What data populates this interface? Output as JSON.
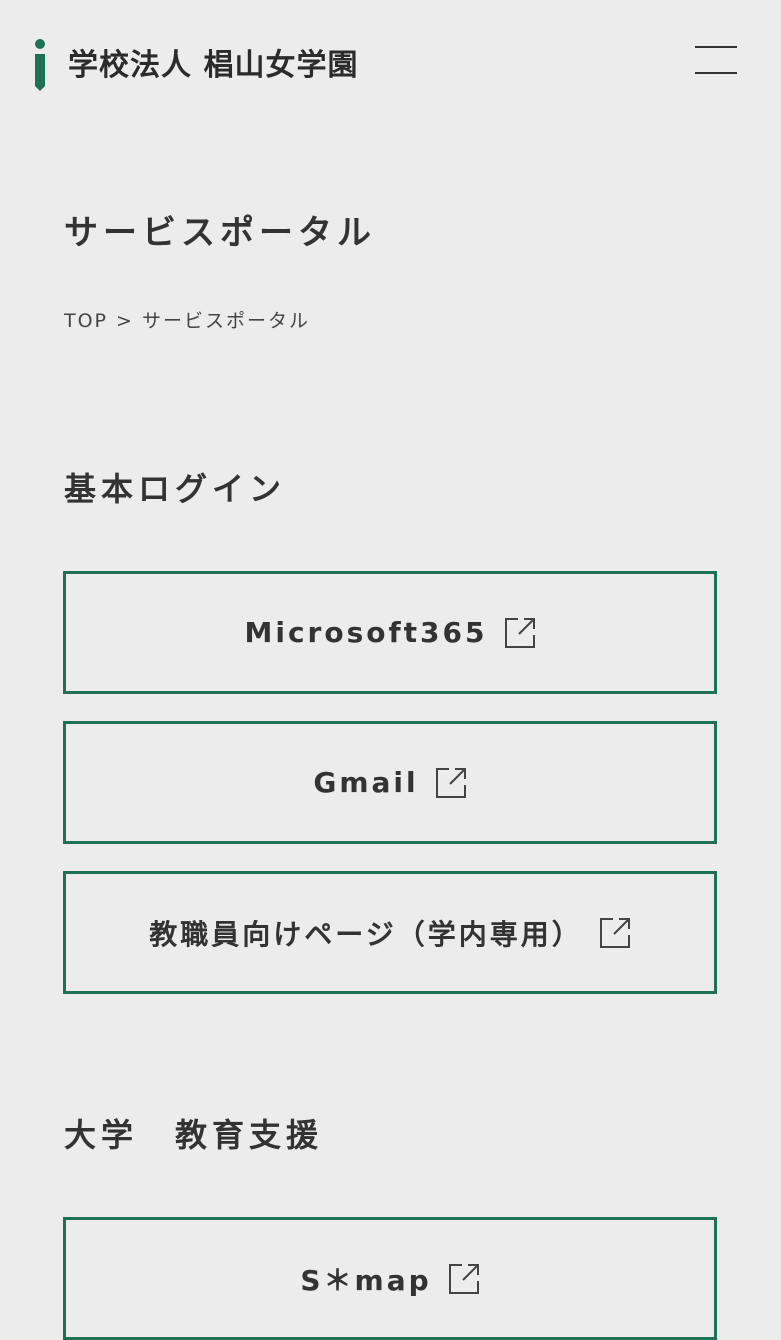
{
  "header": {
    "site_name": "学校法人 椙山女学園",
    "logo_icon": "i-logo-icon",
    "menu_icon": "hamburger-menu-icon"
  },
  "page": {
    "title": "サービスポータル"
  },
  "breadcrumb": {
    "home": "TOP",
    "separator": ">",
    "current": "サービスポータル"
  },
  "sections": [
    {
      "heading": "基本ログイン",
      "links": [
        {
          "label": "Microsoft365",
          "icon": "external-link-icon"
        },
        {
          "label": "Gmail",
          "icon": "external-link-icon"
        },
        {
          "label": "教職員向けページ（学内専用）",
          "icon": "external-link-icon"
        }
      ]
    },
    {
      "heading": "大学　教育支援",
      "links": [
        {
          "label": "S＊map",
          "icon": "external-link-icon"
        }
      ]
    }
  ],
  "colors": {
    "background": "#ececec",
    "accent": "#1f7155",
    "text": "#333333"
  }
}
